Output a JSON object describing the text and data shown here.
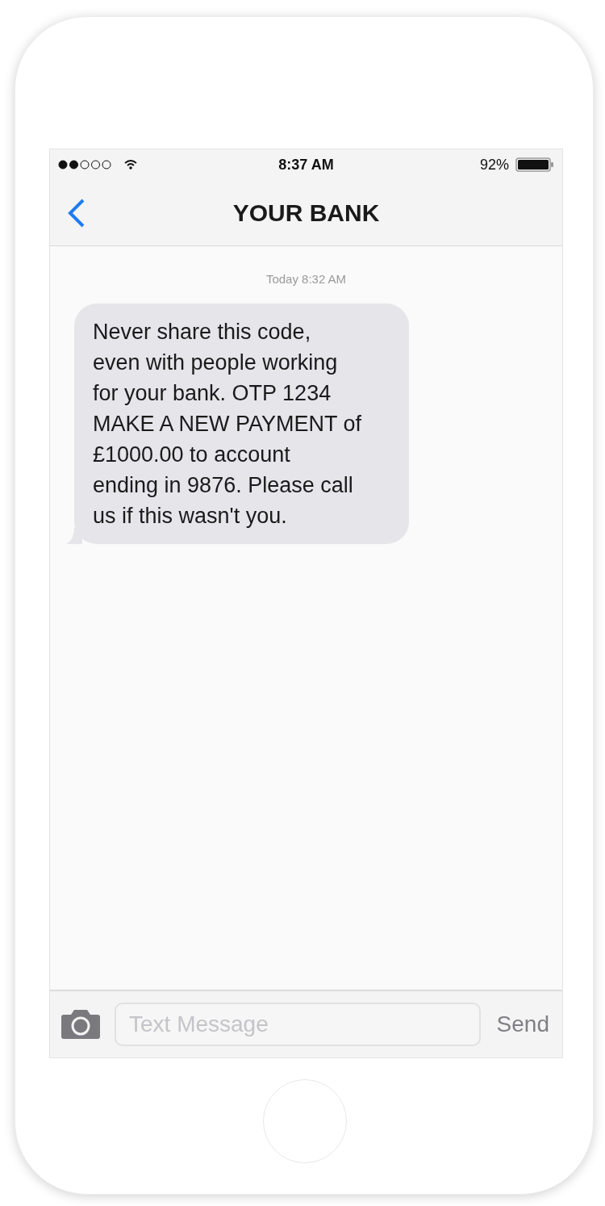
{
  "status_bar": {
    "time": "8:37 AM",
    "battery": "92%"
  },
  "nav": {
    "title": "YOUR BANK"
  },
  "messages": [
    {
      "timestamp": "Today 8:32 AM",
      "lines": [
        "Never share this code,",
        "even with people working",
        "for your bank. OTP 1234",
        "MAKE A NEW PAYMENT of",
        "£1000.00 to account",
        "ending in 9876. Please call",
        "us if this wasn't you."
      ]
    }
  ],
  "composer": {
    "placeholder": "Text Message",
    "send": "Send"
  }
}
